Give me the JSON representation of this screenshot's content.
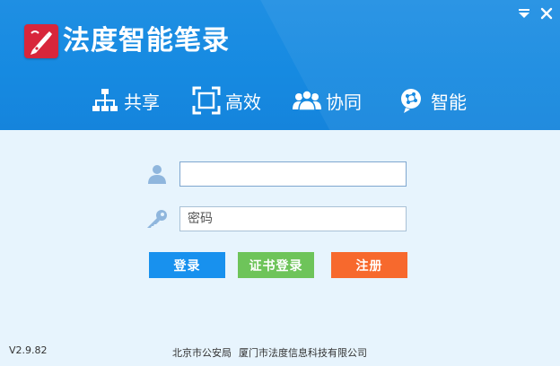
{
  "window": {
    "app_title": "法度智能笔录",
    "controls": {
      "menu_icon": "dropdown-triangle-icon",
      "close_icon": "close-icon"
    }
  },
  "features": [
    {
      "label": "共享",
      "icon": "hierarchy-icon"
    },
    {
      "label": "高效",
      "icon": "frame-icon"
    },
    {
      "label": "协同",
      "icon": "people-icon"
    },
    {
      "label": "智能",
      "icon": "brain-icon"
    }
  ],
  "form": {
    "username": {
      "value": "",
      "placeholder": ""
    },
    "password": {
      "value": "",
      "placeholder": "密码"
    }
  },
  "buttons": {
    "login": "登录",
    "cert_login": "证书登录",
    "register": "注册"
  },
  "footer": {
    "version": "V2.9.82",
    "org1": "北京市公安局",
    "org2": "厦门市法度信息科技有限公司"
  },
  "colors": {
    "header_blue": "#168ae1",
    "body_bg": "#e7f4fd",
    "login_btn": "#1891ee",
    "cert_btn": "#6ec45a",
    "register_btn": "#f7692d",
    "logo_red": "#d8263b",
    "field_icon_blue": "#8fb6dd"
  }
}
